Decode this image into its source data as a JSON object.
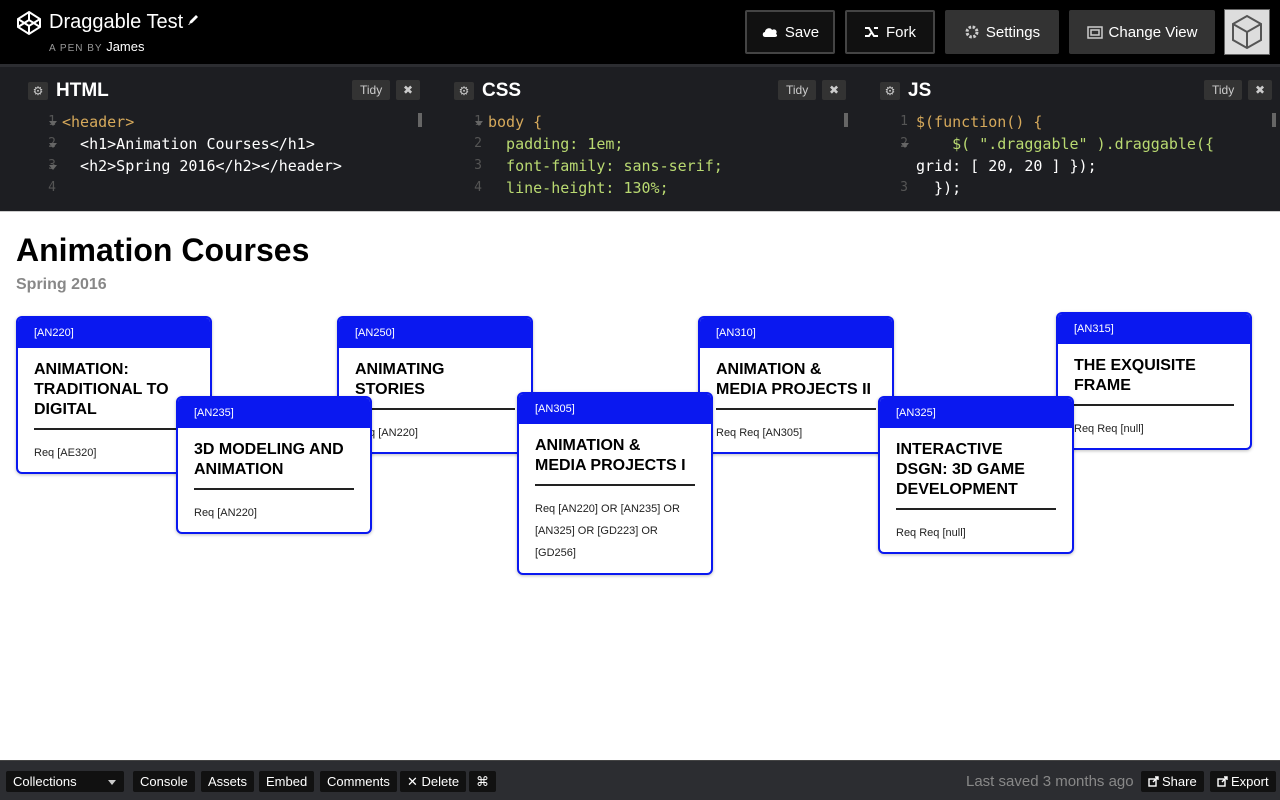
{
  "header": {
    "title": "Draggable Test",
    "by_prefix": "A PEN BY",
    "author": "James",
    "buttons": {
      "save": "Save",
      "fork": "Fork",
      "settings": "Settings",
      "change_view": "Change View"
    }
  },
  "editors": [
    {
      "name": "HTML",
      "tidy": "Tidy",
      "close": "✖",
      "line_numbers": [
        "1",
        "2",
        "3",
        "4"
      ]
    },
    {
      "name": "CSS",
      "tidy": "Tidy",
      "close": "✖",
      "line_numbers": [
        "1",
        "2",
        "3",
        "4"
      ]
    },
    {
      "name": "JS",
      "tidy": "Tidy",
      "close": "✖",
      "line_numbers": [
        "1",
        "2",
        "",
        "3"
      ]
    }
  ],
  "code": {
    "html": [
      "<header>",
      "  <h1>Animation Courses</h1>",
      "  <h2>Spring 2016</h2></header>"
    ],
    "css": [
      "body {",
      "  padding: 1em;",
      "  font-family: sans-serif;",
      "  line-height: 130%;"
    ],
    "js": [
      "$(function() {",
      "    $( \".draggable\" ).draggable({",
      "grid: [ 20, 20 ] });",
      "  });"
    ]
  },
  "preview": {
    "h1": "Animation Courses",
    "h2": "Spring 2016",
    "cards": [
      {
        "code": "[AN220]",
        "title": "ANIMATION:\nTRADITIONAL TO\nDIGITAL",
        "req": "Req [AE320]"
      },
      {
        "code": "[AN235]",
        "title": "3D MODELING AND\nANIMATION",
        "req": "Req [AN220]"
      },
      {
        "code": "[AN250]",
        "title": "ANIMATING\nSTORIES",
        "req": "Req [AN220]"
      },
      {
        "code": "[AN305]",
        "title": "ANIMATION &\nMEDIA PROJECTS I",
        "req": "Req [AN220] OR [AN235] OR [AN325] OR [GD223] OR [GD256]"
      },
      {
        "code": "[AN310]",
        "title": "ANIMATION &\nMEDIA PROJECTS II",
        "req": "Req Req [AN305]"
      },
      {
        "code": "[AN325]",
        "title": "INTERACTIVE\nDSGN: 3D GAME\nDEVELOPMENT",
        "req": "Req Req [null]"
      },
      {
        "code": "[AN315]",
        "title": "THE EXQUISITE\nFRAME",
        "req": "Req Req [null]"
      }
    ]
  },
  "footer": {
    "collections": "Collections",
    "console": "Console",
    "assets": "Assets",
    "embed": "Embed",
    "comments": "Comments",
    "delete": "✕ Delete",
    "shortcut": "⌘",
    "saved": "Last saved 3 months ago",
    "share": "Share",
    "export": "Export"
  },
  "colors": {
    "card_accent": "#0a18f0",
    "topbar": "#000000",
    "editor_bg": "#1d1e22"
  }
}
